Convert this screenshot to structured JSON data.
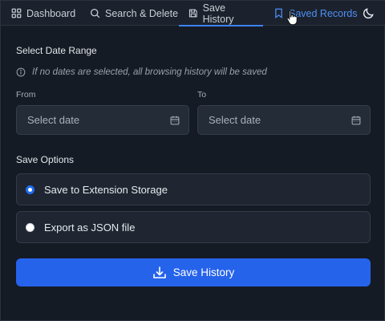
{
  "tabs": [
    {
      "label": "Dashboard",
      "icon": "dashboard-grid-icon"
    },
    {
      "label": "Search & Delete",
      "icon": "search-icon"
    },
    {
      "label": "Save History",
      "icon": "save-icon",
      "active": true
    },
    {
      "label": "Saved Records",
      "icon": "bookmark-icon",
      "hovered": true
    }
  ],
  "theme_toggle_icon": "moon-icon",
  "date_range": {
    "title": "Select Date Range",
    "hint": "If no dates are selected, all browsing history will be saved",
    "from_label": "From",
    "to_label": "To",
    "from_placeholder": "Select date",
    "to_placeholder": "Select date",
    "calendar_icon": "calendar-icon"
  },
  "save_options": {
    "title": "Save Options",
    "options": [
      {
        "label": "Save to Extension Storage",
        "selected": true
      },
      {
        "label": "Export as JSON file",
        "selected": false
      }
    ]
  },
  "save_button": {
    "label": "Save History",
    "icon": "download-icon"
  },
  "colors": {
    "background": "#151b24",
    "accent": "#2563eb",
    "active_tab_text": "#4f8ff7"
  }
}
